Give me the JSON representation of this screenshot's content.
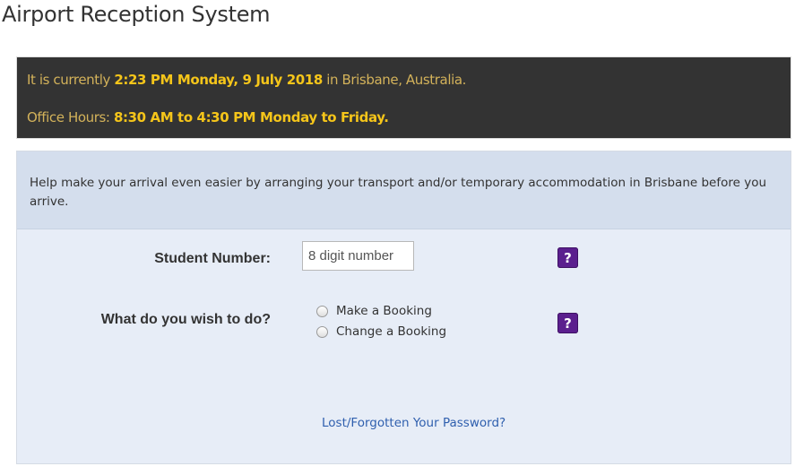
{
  "page": {
    "title": "Airport Reception System"
  },
  "banner": {
    "line1_prefix": "It is currently ",
    "line1_datetime": "2:23 PM Monday, 9 July 2018",
    "line1_suffix": " in Brisbane, Australia.",
    "line2_prefix": "Office Hours: ",
    "line2_hours": "8:30 AM to 4:30 PM Monday to Friday."
  },
  "intro": {
    "text": "Help make your arrival even easier by arranging your transport and/or temporary accommodation in Brisbane before you arrive."
  },
  "form": {
    "student_number": {
      "label": "Student Number:",
      "placeholder": "8 digit number",
      "value": ""
    },
    "action": {
      "label": "What do you wish to do?",
      "options": [
        "Make a Booking",
        "Change a Booking"
      ],
      "selected": null
    },
    "help_icon_glyph": "?"
  },
  "links": {
    "lost_password": "Lost/Forgotten Your Password?"
  },
  "colors": {
    "banner_bg": "#333333",
    "banner_text_muted": "#d3b25a",
    "banner_text_bright": "#f5c51a",
    "panel_bg": "#e7edf7",
    "panel_header_bg": "#d4deed",
    "help_button": "#5b1f8e",
    "link": "#2f5fae"
  },
  "icons": {
    "help": "question-mark-icon",
    "radio": "radio-unchecked-icon"
  }
}
